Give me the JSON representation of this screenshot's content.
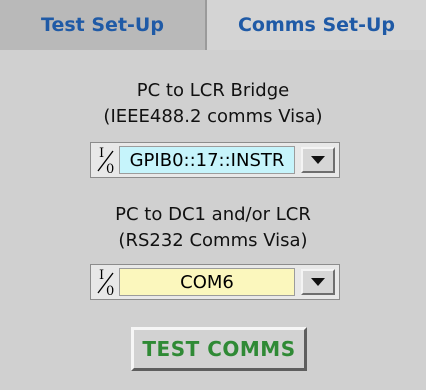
{
  "tabs": [
    {
      "label": "Test Set-Up",
      "selected": false
    },
    {
      "label": "Comms Set-Up",
      "selected": true
    }
  ],
  "lcr": {
    "title_line1": "PC to LCR Bridge",
    "title_line2": "(IEEE488.2 comms Visa)",
    "value": "GPIB0::17::INSTR",
    "field_color": "#c6f4fb"
  },
  "dc1": {
    "title_line1": "PC to DC1 and/or LCR",
    "title_line2": "(RS232 Comms Visa)",
    "value": "COM6",
    "field_color": "#fbf7bd"
  },
  "io_icon": {
    "top": "I",
    "bottom": "0"
  },
  "test_button_label": "TEST COMMS",
  "colors": {
    "tab_text": "#1f5aa6",
    "button_text": "#2f8a35",
    "panel": "#d0d0d0"
  }
}
